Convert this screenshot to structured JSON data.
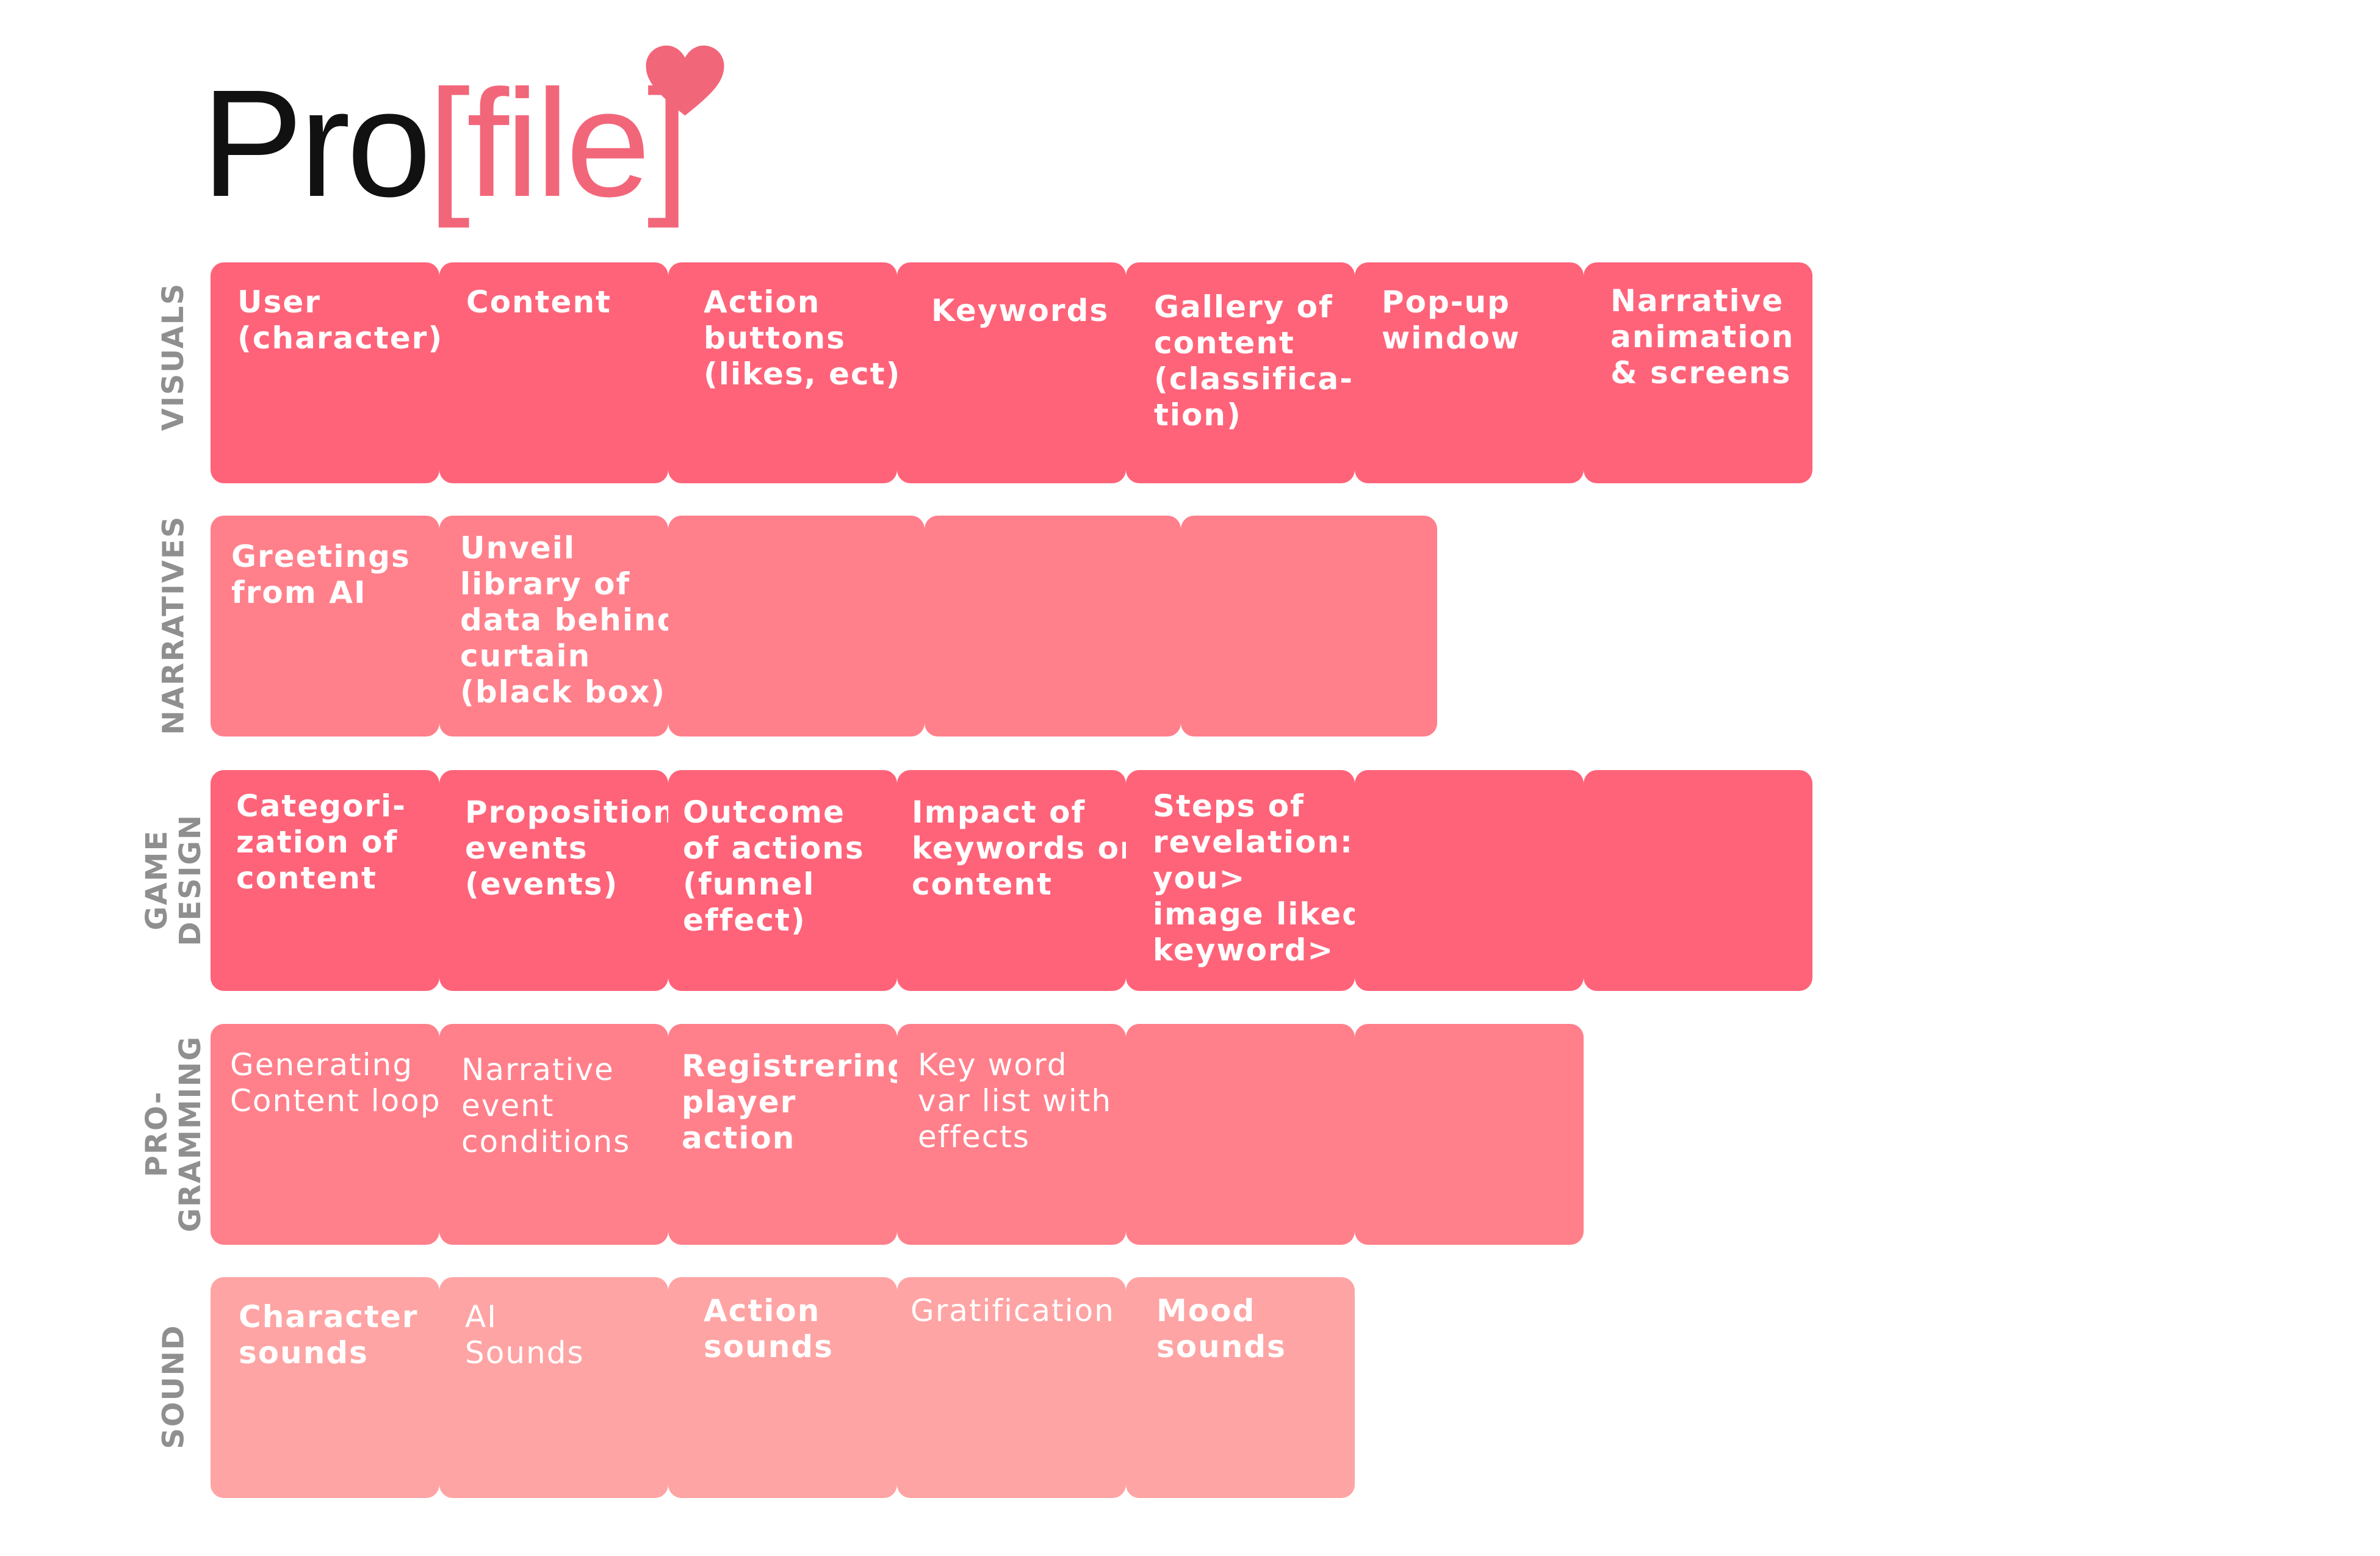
{
  "title": {
    "prefix": "Pro",
    "open_bracket": "[",
    "word": "file",
    "close_bracket": "]"
  },
  "colors": {
    "title_dark": "#111111",
    "accent": "#f2667a",
    "visuals": "#ff6379",
    "narratives": "#ff808b",
    "game_design": "#ff6379",
    "programming": "#ff808b",
    "sound": "#fea4a4",
    "label_gray": "#8f8f8f"
  },
  "rows": [
    {
      "label": "VISUALS",
      "cells": [
        "User\n(character)",
        "Content",
        "Action\nbuttons\n(likes, ect)",
        "Keywords",
        "Gallery of\ncontent\n(classifica-\ntion)",
        "Pop-up\nwindow",
        "Narrative\nanimation\n& screens"
      ]
    },
    {
      "label": "NARRATIVES",
      "cells": [
        "Greetings\nfrom AI",
        "Unveil\nlibrary of\ndata behind\ncurtain\n(black box)",
        "",
        "",
        ""
      ]
    },
    {
      "label": "GAME\nDESIGN",
      "cells": [
        "Categori-\nzation of\ncontent",
        "Proposition\nevents\n(events)",
        "Outcome\nof actions\n(funnel\neffect)",
        "Impact of\nkeywords on\ncontent",
        "Steps of\nrevelation:\nyou>\nimage liked>\nkeyword>",
        "",
        ""
      ]
    },
    {
      "label": "PRO-\nGRAMMING",
      "cells": [
        "Generating\nContent loop",
        "Narrative\nevent\nconditions",
        "Registrering\nplayer\naction",
        "Key word\nvar list with\neffects",
        "",
        ""
      ]
    },
    {
      "label": "SOUND",
      "cells": [
        "Character\nsounds",
        "AI\nSounds",
        "Action\nsounds",
        "Gratification",
        "Mood\nsounds"
      ]
    }
  ]
}
